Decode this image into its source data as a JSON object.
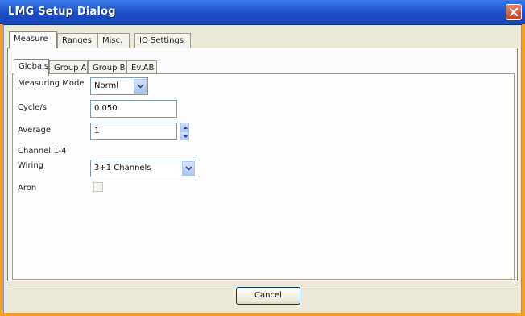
{
  "window": {
    "title": "LMG Setup Dialog",
    "close_icon": "close-x-icon"
  },
  "top_tabs": [
    {
      "label": "Measure",
      "active": true
    },
    {
      "label": "Ranges",
      "active": false
    },
    {
      "label": "Misc.",
      "active": false
    },
    {
      "label": "IO Settings",
      "active": false
    }
  ],
  "inner_tabs": [
    {
      "label": "Globals",
      "active": true
    },
    {
      "label": "Group A",
      "active": false
    },
    {
      "label": "Group B",
      "active": false
    },
    {
      "label": "Ev.AB",
      "active": false
    }
  ],
  "globals": {
    "measuring_mode_label": "Measuring Mode",
    "measuring_mode_value": "Norml",
    "cycle_label": "Cycle/s",
    "cycle_value": "0.050",
    "average_label": "Average",
    "average_value": "1",
    "channel_section_label": "Channel 1-4",
    "wiring_label": "Wiring",
    "wiring_value": "3+1 Channels",
    "aron_label": "Aron",
    "aron_checked": false
  },
  "footer": {
    "cancel_label": "Cancel"
  },
  "colors": {
    "titlebar": "#1b4ec6",
    "frame": "#f0a02a",
    "dialog_bg": "#ece9d8",
    "close_button": "#c8402a"
  }
}
